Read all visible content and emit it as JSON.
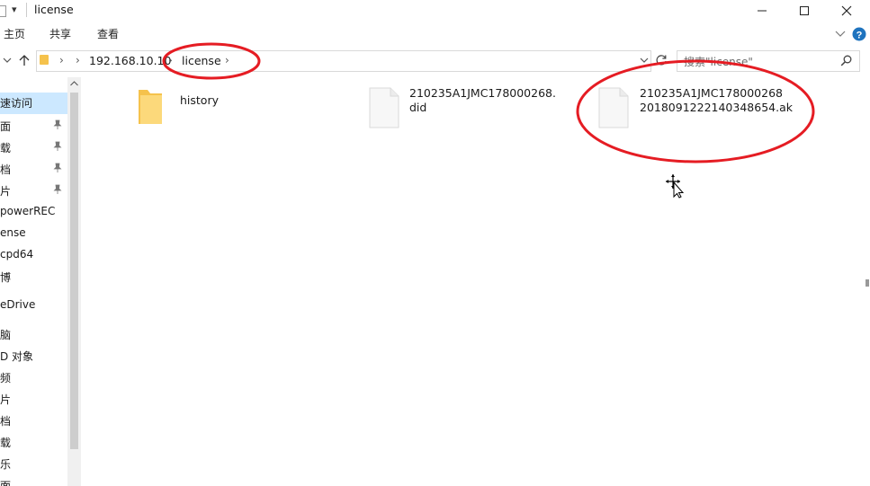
{
  "window": {
    "title": "license",
    "qat_dropdown": "▾"
  },
  "ribbon": {
    "tabs": [
      "主页",
      "共享",
      "查看"
    ]
  },
  "address": {
    "breadcrumb": [
      "192.168.10.10",
      "license"
    ],
    "separator": "›"
  },
  "search": {
    "placeholder": "搜索\"license\""
  },
  "nav": {
    "items": [
      {
        "label": "速访问",
        "selected": true,
        "pinned": false
      },
      {
        "label": "面",
        "pinned": true
      },
      {
        "label": "载",
        "pinned": true
      },
      {
        "label": "档",
        "pinned": true
      },
      {
        "label": "片",
        "pinned": true
      },
      {
        "label": "powerREC",
        "pinned": false
      },
      {
        "label": "ense",
        "pinned": false
      },
      {
        "label": "cpd64",
        "pinned": false
      },
      {
        "label": "博",
        "pinned": false
      },
      {
        "label": "eDrive",
        "pinned": false
      },
      {
        "label": "脑",
        "pinned": false
      },
      {
        "label": "D 对象",
        "pinned": false
      },
      {
        "label": "频",
        "pinned": false
      },
      {
        "label": "片",
        "pinned": false
      },
      {
        "label": "档",
        "pinned": false
      },
      {
        "label": "载",
        "pinned": false
      },
      {
        "label": "乐",
        "pinned": false
      },
      {
        "label": "面",
        "pinned": false
      }
    ]
  },
  "files": [
    {
      "name_line1": "history",
      "name_line2": "",
      "type": "folder"
    },
    {
      "name_line1": "210235A1JMC178000268.",
      "name_line2": "did",
      "type": "file"
    },
    {
      "name_line1": "210235A1JMC178000268",
      "name_line2": "2018091222140348654.ak",
      "type": "file"
    }
  ],
  "colors": {
    "annotation": "#e51c23",
    "folder": "#f5c24c",
    "selection": "#cce8ff",
    "help": "#1e73be"
  }
}
